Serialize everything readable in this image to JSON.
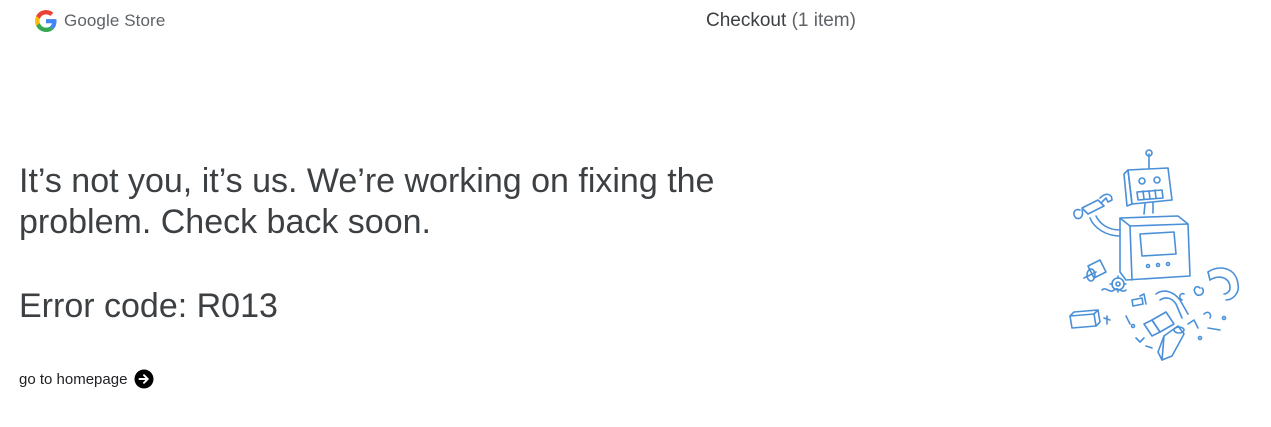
{
  "header": {
    "logo_text": "Google Store",
    "checkout_label": "Checkout",
    "item_count": "(1 item)"
  },
  "main": {
    "message": "It’s not you, it’s us. We’re working on fixing the problem. Check back soon.",
    "error_code": "Error code: R013",
    "home_link": "go to homepage"
  },
  "icons": {
    "logo": "google-g-icon",
    "link_arrow": "arrow-right-circle-icon",
    "illustration": "broken-robot-illustration"
  },
  "colors": {
    "text": "#3c4043",
    "muted": "#5f6368",
    "link": "#202124",
    "illustration_stroke": "#4a90d9",
    "google_blue": "#4285F4",
    "google_red": "#EA4335",
    "google_yellow": "#FBBC05",
    "google_green": "#34A853"
  }
}
